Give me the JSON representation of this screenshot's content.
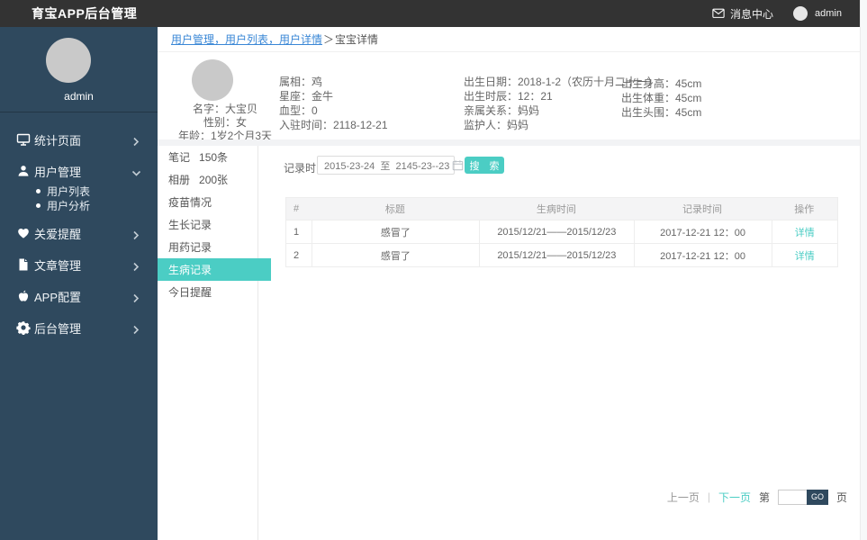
{
  "topbar": {
    "title": "育宝APP后台管理",
    "message_center": "消息中心",
    "user": "admin"
  },
  "sidebar": {
    "username": "admin",
    "items": [
      {
        "label": "统计页面",
        "icon": "monitor-icon",
        "chevron": "right"
      },
      {
        "label": "用户管理",
        "icon": "user-icon",
        "chevron": "down",
        "children": [
          {
            "label": "用户列表"
          },
          {
            "label": "用户分析"
          }
        ]
      },
      {
        "label": "关爱提醒",
        "icon": "heart-icon",
        "chevron": "right"
      },
      {
        "label": "文章管理",
        "icon": "document-icon",
        "chevron": "right"
      },
      {
        "label": "APP配置",
        "icon": "apple-icon",
        "chevron": "right"
      },
      {
        "label": "后台管理",
        "icon": "gear-icon",
        "chevron": "right"
      }
    ]
  },
  "breadcrumb": {
    "links": "用户管理，用户列表，用户详情",
    "separator": "＞",
    "current": "宝宝详情"
  },
  "profile": {
    "name": "名字：大宝贝",
    "gender": "性别：女",
    "age": "年龄：1岁2个月3天",
    "col2": [
      "属相：鸡",
      "星座：金牛",
      "血型：0",
      "入驻时间：2118-12-21"
    ],
    "col3": [
      "出生日期：2018-1-2（农历十月二十一）",
      "出生时辰：12：21",
      "亲属关系：妈妈",
      "监护人：妈妈"
    ],
    "col4": [
      "出生身高：45cm",
      "出生体重：45cm",
      "出生头围：45cm"
    ]
  },
  "subnav": {
    "items": [
      {
        "label": "笔记",
        "count": "150条"
      },
      {
        "label": "相册",
        "count": "200张"
      },
      {
        "label": "疫苗情况"
      },
      {
        "label": "生长记录"
      },
      {
        "label": "用药记录"
      },
      {
        "label": "生病记录",
        "active": true
      },
      {
        "label": "今日提醒"
      }
    ]
  },
  "filter": {
    "label": "记录时间：",
    "range_value": "2015-23-24  至  2145-23--23",
    "calendar_icon": "calendar-icon",
    "search_button": "搜 索"
  },
  "table": {
    "headers": [
      "#",
      "标题",
      "生病时间",
      "记录时间",
      "操作"
    ],
    "rows": [
      {
        "index": "1",
        "title": "感冒了",
        "sick_time": "2015/12/21——2015/12/23",
        "record_time": "2017-12-21  12：00",
        "action": "详情"
      },
      {
        "index": "2",
        "title": "感冒了",
        "sick_time": "2015/12/21——2015/12/23",
        "record_time": "2017-12-21  12：00",
        "action": "详情"
      }
    ]
  },
  "pagination": {
    "prev": "上一页",
    "separator": "|",
    "next": "下一页",
    "page_prefix": "第",
    "go": "GO",
    "page_suffix": "页"
  },
  "colors": {
    "topbar_bg": "#333333",
    "sidebar_bg": "#2f495e",
    "accent_teal": "#4bcdc4",
    "link_blue": "#3a87d6"
  }
}
